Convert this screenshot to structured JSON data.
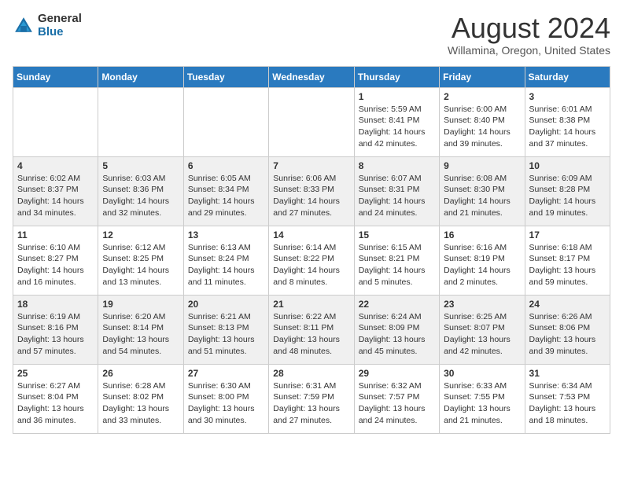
{
  "header": {
    "logo_general": "General",
    "logo_blue": "Blue",
    "month_title": "August 2024",
    "location": "Willamina, Oregon, United States"
  },
  "days_of_week": [
    "Sunday",
    "Monday",
    "Tuesday",
    "Wednesday",
    "Thursday",
    "Friday",
    "Saturday"
  ],
  "weeks": [
    [
      {
        "day": "",
        "info": ""
      },
      {
        "day": "",
        "info": ""
      },
      {
        "day": "",
        "info": ""
      },
      {
        "day": "",
        "info": ""
      },
      {
        "day": "1",
        "info": "Sunrise: 5:59 AM\nSunset: 8:41 PM\nDaylight: 14 hours\nand 42 minutes."
      },
      {
        "day": "2",
        "info": "Sunrise: 6:00 AM\nSunset: 8:40 PM\nDaylight: 14 hours\nand 39 minutes."
      },
      {
        "day": "3",
        "info": "Sunrise: 6:01 AM\nSunset: 8:38 PM\nDaylight: 14 hours\nand 37 minutes."
      }
    ],
    [
      {
        "day": "4",
        "info": "Sunrise: 6:02 AM\nSunset: 8:37 PM\nDaylight: 14 hours\nand 34 minutes."
      },
      {
        "day": "5",
        "info": "Sunrise: 6:03 AM\nSunset: 8:36 PM\nDaylight: 14 hours\nand 32 minutes."
      },
      {
        "day": "6",
        "info": "Sunrise: 6:05 AM\nSunset: 8:34 PM\nDaylight: 14 hours\nand 29 minutes."
      },
      {
        "day": "7",
        "info": "Sunrise: 6:06 AM\nSunset: 8:33 PM\nDaylight: 14 hours\nand 27 minutes."
      },
      {
        "day": "8",
        "info": "Sunrise: 6:07 AM\nSunset: 8:31 PM\nDaylight: 14 hours\nand 24 minutes."
      },
      {
        "day": "9",
        "info": "Sunrise: 6:08 AM\nSunset: 8:30 PM\nDaylight: 14 hours\nand 21 minutes."
      },
      {
        "day": "10",
        "info": "Sunrise: 6:09 AM\nSunset: 8:28 PM\nDaylight: 14 hours\nand 19 minutes."
      }
    ],
    [
      {
        "day": "11",
        "info": "Sunrise: 6:10 AM\nSunset: 8:27 PM\nDaylight: 14 hours\nand 16 minutes."
      },
      {
        "day": "12",
        "info": "Sunrise: 6:12 AM\nSunset: 8:25 PM\nDaylight: 14 hours\nand 13 minutes."
      },
      {
        "day": "13",
        "info": "Sunrise: 6:13 AM\nSunset: 8:24 PM\nDaylight: 14 hours\nand 11 minutes."
      },
      {
        "day": "14",
        "info": "Sunrise: 6:14 AM\nSunset: 8:22 PM\nDaylight: 14 hours\nand 8 minutes."
      },
      {
        "day": "15",
        "info": "Sunrise: 6:15 AM\nSunset: 8:21 PM\nDaylight: 14 hours\nand 5 minutes."
      },
      {
        "day": "16",
        "info": "Sunrise: 6:16 AM\nSunset: 8:19 PM\nDaylight: 14 hours\nand 2 minutes."
      },
      {
        "day": "17",
        "info": "Sunrise: 6:18 AM\nSunset: 8:17 PM\nDaylight: 13 hours\nand 59 minutes."
      }
    ],
    [
      {
        "day": "18",
        "info": "Sunrise: 6:19 AM\nSunset: 8:16 PM\nDaylight: 13 hours\nand 57 minutes."
      },
      {
        "day": "19",
        "info": "Sunrise: 6:20 AM\nSunset: 8:14 PM\nDaylight: 13 hours\nand 54 minutes."
      },
      {
        "day": "20",
        "info": "Sunrise: 6:21 AM\nSunset: 8:13 PM\nDaylight: 13 hours\nand 51 minutes."
      },
      {
        "day": "21",
        "info": "Sunrise: 6:22 AM\nSunset: 8:11 PM\nDaylight: 13 hours\nand 48 minutes."
      },
      {
        "day": "22",
        "info": "Sunrise: 6:24 AM\nSunset: 8:09 PM\nDaylight: 13 hours\nand 45 minutes."
      },
      {
        "day": "23",
        "info": "Sunrise: 6:25 AM\nSunset: 8:07 PM\nDaylight: 13 hours\nand 42 minutes."
      },
      {
        "day": "24",
        "info": "Sunrise: 6:26 AM\nSunset: 8:06 PM\nDaylight: 13 hours\nand 39 minutes."
      }
    ],
    [
      {
        "day": "25",
        "info": "Sunrise: 6:27 AM\nSunset: 8:04 PM\nDaylight: 13 hours\nand 36 minutes."
      },
      {
        "day": "26",
        "info": "Sunrise: 6:28 AM\nSunset: 8:02 PM\nDaylight: 13 hours\nand 33 minutes."
      },
      {
        "day": "27",
        "info": "Sunrise: 6:30 AM\nSunset: 8:00 PM\nDaylight: 13 hours\nand 30 minutes."
      },
      {
        "day": "28",
        "info": "Sunrise: 6:31 AM\nSunset: 7:59 PM\nDaylight: 13 hours\nand 27 minutes."
      },
      {
        "day": "29",
        "info": "Sunrise: 6:32 AM\nSunset: 7:57 PM\nDaylight: 13 hours\nand 24 minutes."
      },
      {
        "day": "30",
        "info": "Sunrise: 6:33 AM\nSunset: 7:55 PM\nDaylight: 13 hours\nand 21 minutes."
      },
      {
        "day": "31",
        "info": "Sunrise: 6:34 AM\nSunset: 7:53 PM\nDaylight: 13 hours\nand 18 minutes."
      }
    ]
  ]
}
